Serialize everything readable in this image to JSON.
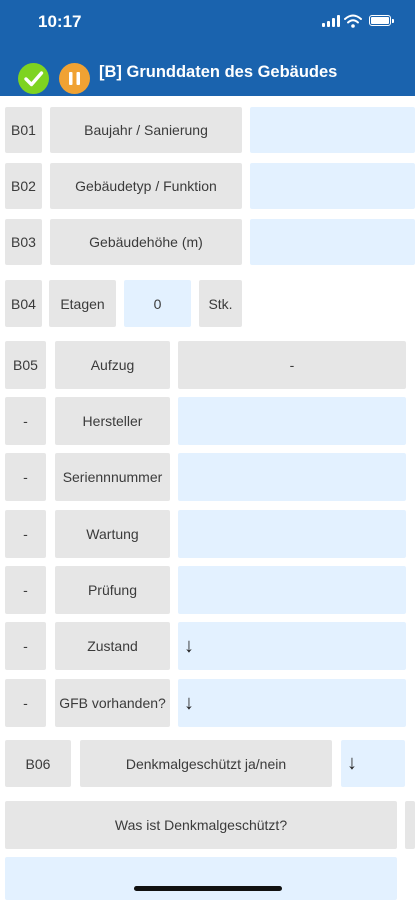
{
  "status": {
    "time": "10:17"
  },
  "nav": {
    "title": "[B] Grunddaten des Gebäudes"
  },
  "rows": {
    "b01": {
      "code": "B01",
      "label": "Baujahr / Sanierung",
      "value": ""
    },
    "b02": {
      "code": "B02",
      "label": "Gebäudetyp / Funktion",
      "value": ""
    },
    "b03": {
      "code": "B03",
      "label": "Gebäudehöhe (m)",
      "value": ""
    },
    "b04": {
      "code": "B04",
      "label": "Etagen",
      "value": "0",
      "unit": "Stk."
    },
    "b05": {
      "code": "B05",
      "label": "Aufzug",
      "value": "-"
    },
    "hersteller": {
      "code": "-",
      "label": "Hersteller",
      "value": ""
    },
    "seriennummer": {
      "code": "-",
      "label": "Seriennnummer",
      "value": ""
    },
    "wartung": {
      "code": "-",
      "label": "Wartung",
      "value": ""
    },
    "pruefung": {
      "code": "-",
      "label": "Prüfung",
      "value": ""
    },
    "zustand": {
      "code": "-",
      "label": "Zustand",
      "value": "↓"
    },
    "gfb": {
      "code": "-",
      "label": "GFB vorhanden?",
      "value": "↓"
    },
    "b06": {
      "code": "B06",
      "label": "Denkmalgeschützt ja/nein",
      "value": "↓"
    },
    "denkmal": {
      "label": "Was ist Denkmalgeschützt?",
      "value": ""
    }
  },
  "colors": {
    "header": "#1a63ae",
    "button": "#e6e6e6",
    "field": "#e3f1ff",
    "check": "#7ed321",
    "pause": "#f0a233"
  },
  "icons": {
    "save": "check-circle-icon",
    "pause": "pause-circle-icon",
    "dropdown": "arrow-down-icon"
  }
}
